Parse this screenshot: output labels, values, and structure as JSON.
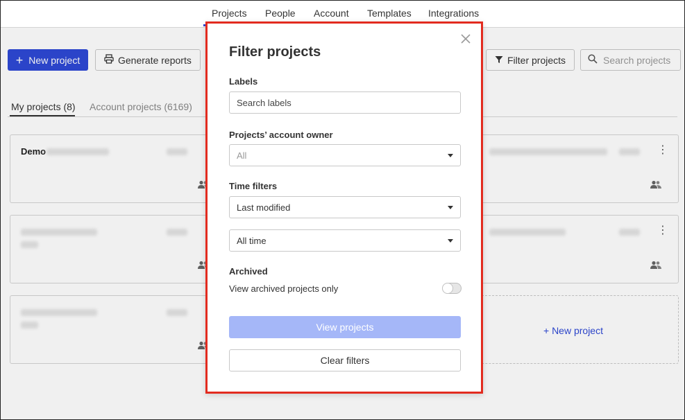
{
  "topnav": {
    "items": [
      "Projects",
      "People",
      "Account",
      "Templates",
      "Integrations"
    ]
  },
  "toolbar": {
    "new_project_label": "New project",
    "generate_reports_label": "Generate reports",
    "filter_projects_label": "Filter projects",
    "search_placeholder": "Search projects"
  },
  "tabs": {
    "my_projects": "My projects (8)",
    "account_projects": "Account projects (6169)"
  },
  "cards": {
    "first_title": "Demo",
    "new_project_link": "+ New project"
  },
  "modal": {
    "title": "Filter projects",
    "labels_heading": "Labels",
    "labels_placeholder": "Search labels",
    "owner_heading": "Projects’ account owner",
    "owner_value": "All",
    "time_heading": "Time filters",
    "time_sort_value": "Last modified",
    "time_range_value": "All time",
    "archived_heading": "Archived",
    "archived_text": "View archived projects only",
    "archived_on": false,
    "view_button": "View projects",
    "clear_button": "Clear filters"
  },
  "colors": {
    "primary": "#2e49d6",
    "disabled_primary": "#a5b7f8",
    "highlight_border": "#e22b1f"
  }
}
